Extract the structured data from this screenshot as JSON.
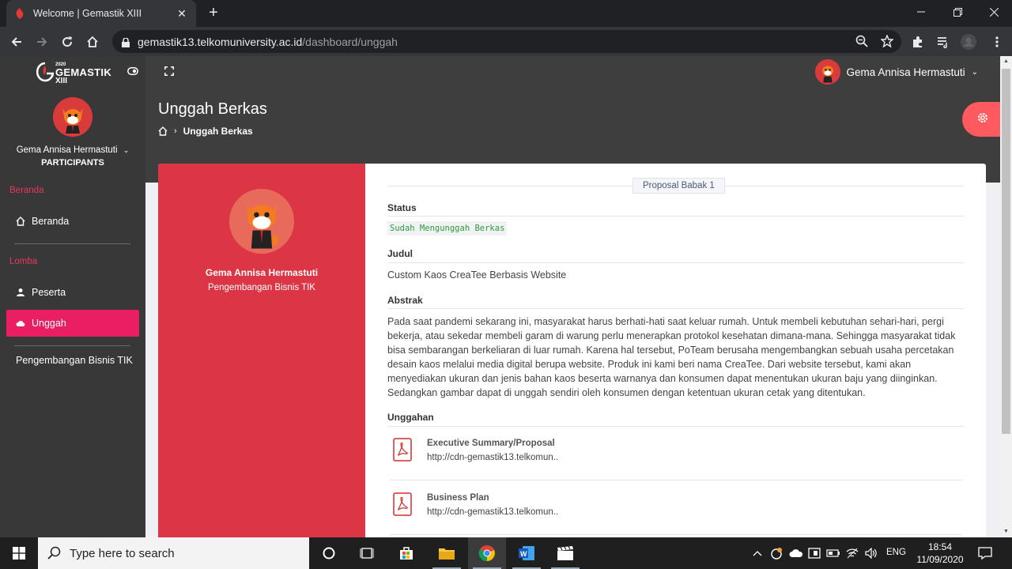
{
  "browser": {
    "tab_title": "Welcome | Gemastik XIII",
    "url_host": "gemastik13.telkomuniversity.ac.id",
    "url_path": "/dashboard/unggah"
  },
  "app": {
    "logo": {
      "year": "2020",
      "name": "GEMASTIK",
      "edition": "XIII"
    },
    "top_user": "Gema Annisa Hermastuti"
  },
  "sidebar": {
    "user_name": "Gema Annisa Hermastuti",
    "user_role": "PARTICIPANTS",
    "section_home": "Beranda",
    "item_home": "Beranda",
    "section_lomba": "Lomba",
    "item_peserta": "Peserta",
    "item_unggah": "Unggah",
    "category": "Pengembangan Bisnis TIK"
  },
  "header": {
    "page_title": "Unggah Berkas",
    "breadcrumb_current": "Unggah Berkas"
  },
  "card": {
    "name": "Gema Annisa Hermastuti",
    "category": "Pengembangan Bisnis TIK",
    "round": "Proposal Babak 1",
    "status_label": "Status",
    "status_value": "Sudah Mengunggah Berkas",
    "judul_label": "Judul",
    "judul_value": "Custom Kaos CreaTee Berbasis Website",
    "abstrak_label": "Abstrak",
    "abstrak_value": "Pada saat pandemi sekarang ini, masyarakat harus berhati-hati saat keluar rumah. Untuk membeli kebutuhan sehari-hari, pergi bekerja, atau sekedar membeli garam di warung perlu menerapkan protokol kesehatan dimana-mana. Sehingga masyarakat tidak bisa sembarangan berkeliaran di luar rumah. Karena hal tersebut, PoTeam berusaha mengembangkan sebuah usaha percetakan desain kaos melalui media digital berupa website. Produk ini kami beri nama CreaTee. Dari website tersebut, kami akan menyediakan ukuran dan jenis bahan kaos beserta warnanya dan konsumen dapat menentukan ukuran baju yang diinginkan. Sedangkan gambar dapat di unggah sendiri oleh konsumen dengan ketentuan ukuran cetak yang ditentukan.",
    "uploads_label": "Unggahan",
    "files": [
      {
        "name": "Executive Summary/Proposal",
        "url": "http://cdn-gemastik13.telkomun.."
      },
      {
        "name": "Business Plan",
        "url": "http://cdn-gemastik13.telkomun.."
      }
    ]
  },
  "taskbar": {
    "search_placeholder": "Type here to search",
    "lang": "ENG",
    "time": "18:54",
    "date": "11/09/2020"
  },
  "colors": {
    "accent_red": "#dc3545",
    "accent_pink": "#e91e63",
    "status_green": "#2e9d3a"
  }
}
